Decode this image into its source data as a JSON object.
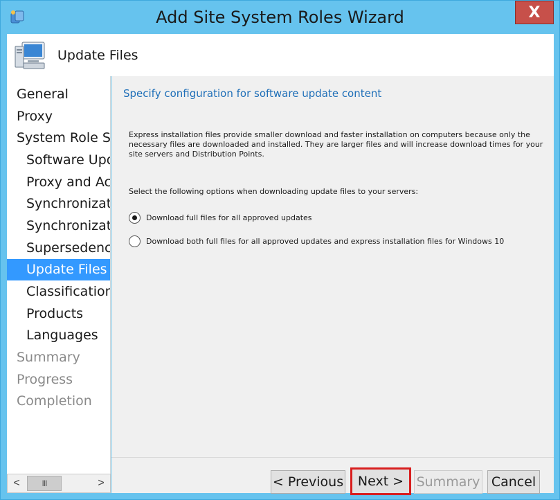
{
  "window": {
    "title": "Add Site System Roles Wizard",
    "close_label": "X"
  },
  "header": {
    "title": "Update Files"
  },
  "nav": {
    "items": [
      {
        "label": "General",
        "level": 0,
        "state": "normal"
      },
      {
        "label": "Proxy",
        "level": 0,
        "state": "normal"
      },
      {
        "label": "System Role Selection",
        "level": 0,
        "state": "normal"
      },
      {
        "label": "Software Update Point",
        "level": 1,
        "state": "normal"
      },
      {
        "label": "Proxy and Account Settings",
        "level": 1,
        "state": "normal"
      },
      {
        "label": "Synchronization Source",
        "level": 1,
        "state": "normal"
      },
      {
        "label": "Synchronization Schedule",
        "level": 1,
        "state": "normal"
      },
      {
        "label": "Supersedence Rules",
        "level": 1,
        "state": "normal"
      },
      {
        "label": "Update Files",
        "level": 1,
        "state": "active"
      },
      {
        "label": "Classifications",
        "level": 1,
        "state": "normal"
      },
      {
        "label": "Products",
        "level": 1,
        "state": "normal"
      },
      {
        "label": "Languages",
        "level": 1,
        "state": "normal"
      },
      {
        "label": "Summary",
        "level": 0,
        "state": "disabled"
      },
      {
        "label": "Progress",
        "level": 0,
        "state": "disabled"
      },
      {
        "label": "Completion",
        "level": 0,
        "state": "disabled"
      }
    ],
    "scroll_left": "<",
    "scroll_right": ">",
    "scroll_thumb": "III"
  },
  "content": {
    "heading": "Specify configuration for software update content",
    "description": "Express installation files provide smaller download and faster installation on computers because only the necessary files are downloaded and installed.  They are larger files and will increase download times for your site servers and Distribution Points.",
    "prompt": "Select the following options when downloading update files to your servers:",
    "options": [
      {
        "label": "Download full files for all approved updates",
        "selected": true
      },
      {
        "label": "Download both full files for all approved updates and express installation files for Windows 10",
        "selected": false
      }
    ]
  },
  "footer": {
    "previous_label": "< Previous",
    "next_label": "Next >",
    "summary_label": "Summary",
    "cancel_label": "Cancel"
  },
  "colors": {
    "accent": "#3399ff",
    "heading": "#1f6fb8",
    "close": "#c7504a",
    "highlight_border": "#d81e1e"
  }
}
